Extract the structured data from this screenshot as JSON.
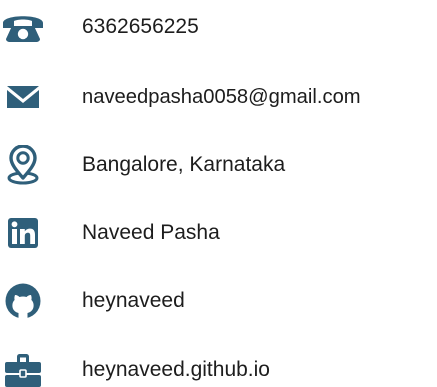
{
  "accent_color": "#2f5f7a",
  "contacts": [
    {
      "icon": "phone-icon",
      "text": "6362656225"
    },
    {
      "icon": "envelope-icon",
      "text": "naveedpasha0058@gmail.com"
    },
    {
      "icon": "location-pin-icon",
      "text": "Bangalore, Karnataka"
    },
    {
      "icon": "linkedin-icon",
      "text": "Naveed Pasha"
    },
    {
      "icon": "github-icon",
      "text": "heynaveed"
    },
    {
      "icon": "briefcase-icon",
      "text": "heynaveed.github.io"
    }
  ]
}
